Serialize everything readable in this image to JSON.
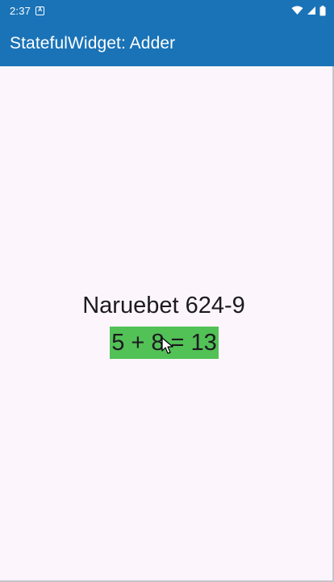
{
  "status_bar": {
    "time": "2:37",
    "notification_icon": "a-letter-icon",
    "icons": [
      "wifi-icon",
      "signal-icon",
      "battery-icon"
    ]
  },
  "app_bar": {
    "title": "StatefulWidget: Adder",
    "color": "#1a73b7"
  },
  "content": {
    "student_label": "Naruebet 624-9",
    "sum_text": "5 + 8 = 13",
    "sum_background": "#52c156"
  }
}
